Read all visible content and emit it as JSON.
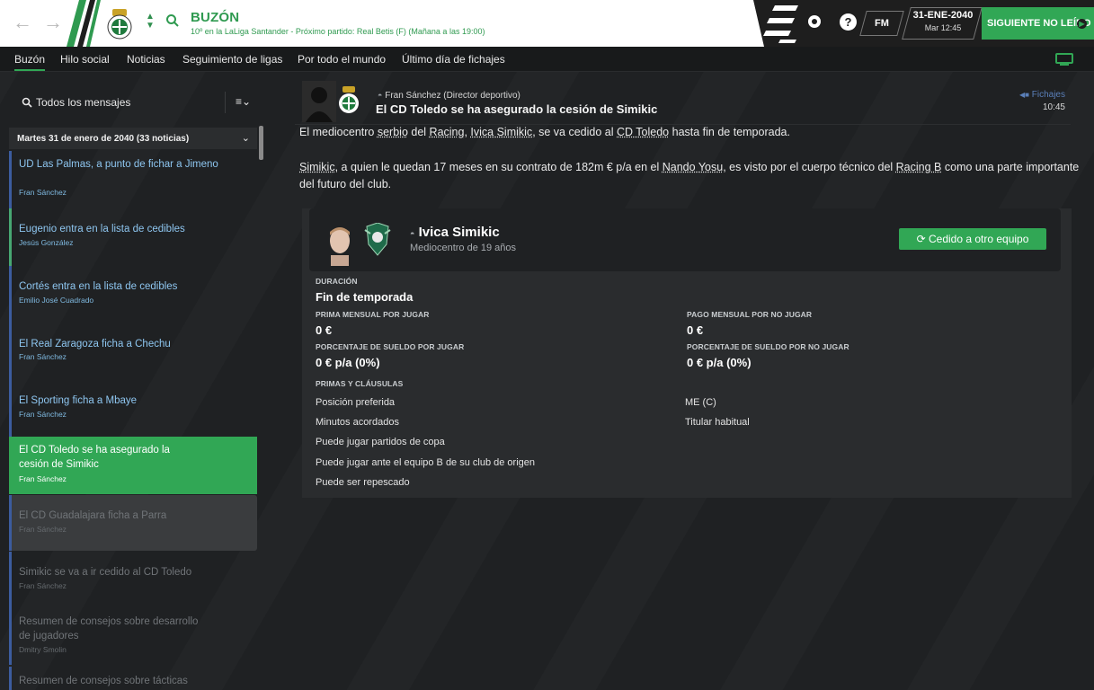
{
  "header": {
    "title": "BUZÓN",
    "subtitle": "10º en la LaLiga Santander - Próximo partido: Real Betis (F) (Mañana a las 19:00)",
    "fm_logo": "FM",
    "date_main": "31-ENE-2040",
    "date_sub": "Mar 12:45",
    "continue_label": "SIGUIENTE NO LEÍDO",
    "accent_color": "#31a755"
  },
  "tabs": [
    {
      "label": "Buzón"
    },
    {
      "label": "Hilo social"
    },
    {
      "label": "Noticias"
    },
    {
      "label": "Seguimiento de ligas"
    },
    {
      "label": "Por todo el mundo"
    },
    {
      "label": "Último día de fichajes"
    }
  ],
  "sidebar": {
    "filter_label": "Todos los mensajes",
    "group_title": "Martes 31 de enero de 2040 (33 noticias)",
    "messages": [
      {
        "title": "UD Las Palmas, a punto de fichar a Jimeno",
        "from": "Fran Sánchez"
      },
      {
        "title": "Eugenio entra en la lista de cedibles",
        "from": "Jesús González"
      },
      {
        "title": "Cortés entra en la lista de cedibles",
        "from": "Emilio José Cuadrado"
      },
      {
        "title": "El Real Zaragoza ficha a Chechu",
        "from": "Fran Sánchez"
      },
      {
        "title": "El Sporting ficha a Mbaye",
        "from": "Fran Sánchez"
      },
      {
        "title": "El CD Toledo se ha asegurado la cesión de Simikic",
        "from": "Fran Sánchez"
      },
      {
        "title": "El CD Guadalajara ficha a Parra",
        "from": "Fran Sánchez"
      },
      {
        "title": "Simikic se va a ir cedido al CD Toledo",
        "from": "Fran Sánchez"
      },
      {
        "title": "Resumen de consejos sobre desarrollo de jugadores",
        "from": "Dmitry Smolin"
      },
      {
        "title": "Resumen de consejos sobre tácticas",
        "from": ""
      }
    ]
  },
  "mail": {
    "sender": "Fran Sánchez  (Director deportivo)",
    "subject": "El CD Toledo se ha asegurado la cesión de Simikic",
    "tag": "Fichajes",
    "time": "10:45",
    "p1_pre": "El mediocentro ",
    "p1_a": "serbio",
    "p1_mid1": " del ",
    "p1_b": "Racing",
    "p1_mid2": ", ",
    "p1_c": "Ivica Simikic",
    "p1_mid3": ", se va cedido al ",
    "p1_d": "CD Toledo",
    "p1_post": " hasta fin de temporada.",
    "p2_a": "Simikic",
    "p2_mid1": ", a quien le quedan 17 meses en su contrato de 182m € p/a en el ",
    "p2_b": "Nando Yosu",
    "p2_mid2": ", es visto por el cuerpo técnico del ",
    "p2_c": "Racing B",
    "p2_post": " como una parte importante del futuro del club."
  },
  "card": {
    "player_name": "Ivica Simikic",
    "player_desc": "Mediocentro de 19 años",
    "status": "Cedido a otro equipo",
    "duration_label": "DURACIÓN",
    "duration_value": "Fin de temporada",
    "bonus_play_label": "PRIMA MENSUAL POR JUGAR",
    "bonus_play_value": "0 €",
    "pay_noplay_label": "PAGO MENSUAL POR NO JUGAR",
    "pay_noplay_value": "0 €",
    "pct_play_label": "PORCENTAJE DE SUELDO POR JUGAR",
    "pct_play_value": "0 € p/a (0%)",
    "pct_noplay_label": "PORCENTAJE DE SUELDO POR NO JUGAR",
    "pct_noplay_value": "0 € p/a (0%)",
    "clauses_label": "PRIMAS Y CLÁUSULAS",
    "clauses": [
      {
        "label": "Posición preferida",
        "value": "ME (C)"
      },
      {
        "label": "Minutos acordados",
        "value": "Titular habitual"
      },
      {
        "label": "Puede jugar partidos de copa",
        "value": ""
      },
      {
        "label": "Puede jugar ante el equipo B de su club de origen",
        "value": ""
      },
      {
        "label": "Puede ser repescado",
        "value": ""
      }
    ]
  }
}
